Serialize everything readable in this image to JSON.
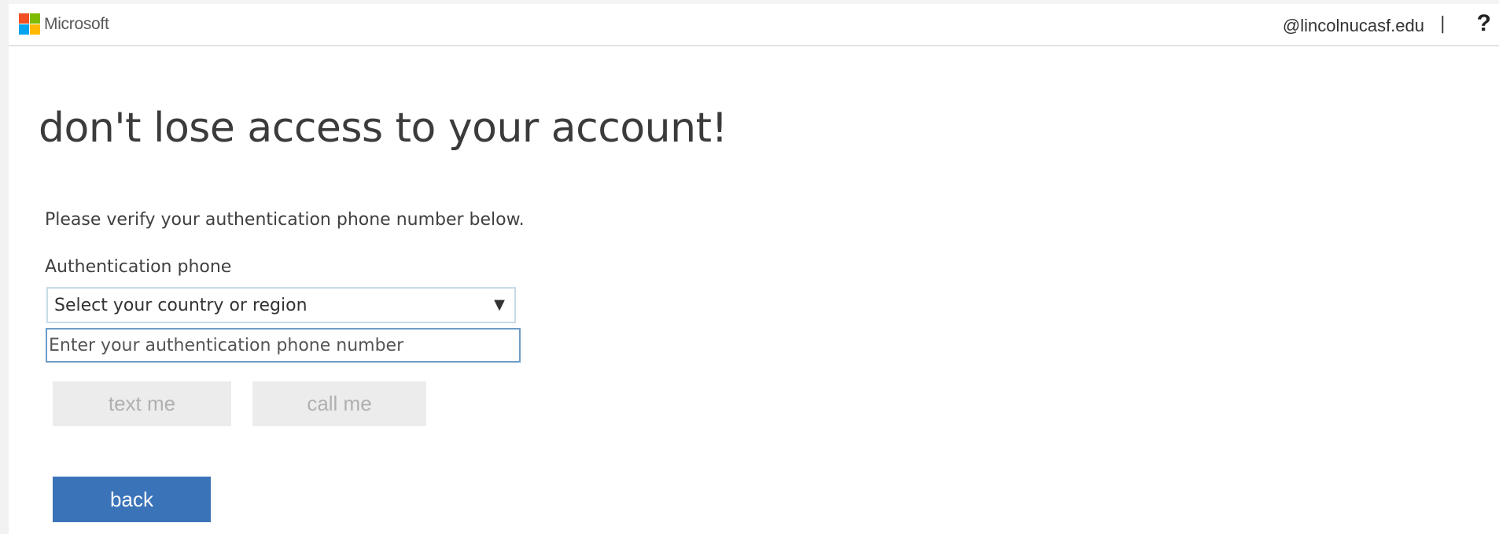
{
  "header": {
    "brand": "Microsoft",
    "user_email": "@lincolnucasf.edu",
    "separator": "|",
    "help_label": "?",
    "logo_colors": [
      "#f25022",
      "#7fba00",
      "#00a4ef",
      "#ffb900"
    ]
  },
  "main": {
    "title": "don't lose access to your account!",
    "instructions": "Please verify your authentication phone number below.",
    "phone_label": "Authentication phone",
    "country_select": {
      "selected": "Select your country or region",
      "arrow_icon": "triangle-down"
    },
    "phone_input": {
      "value": "",
      "placeholder": "Enter your authentication phone number"
    },
    "buttons": {
      "text_me": "text me",
      "call_me": "call me",
      "back": "back"
    }
  },
  "colors": {
    "accent": "#3b73b9",
    "disabled_bg": "#ececec",
    "disabled_text": "#b0b0b0",
    "input_border": "#6d9cc7"
  }
}
